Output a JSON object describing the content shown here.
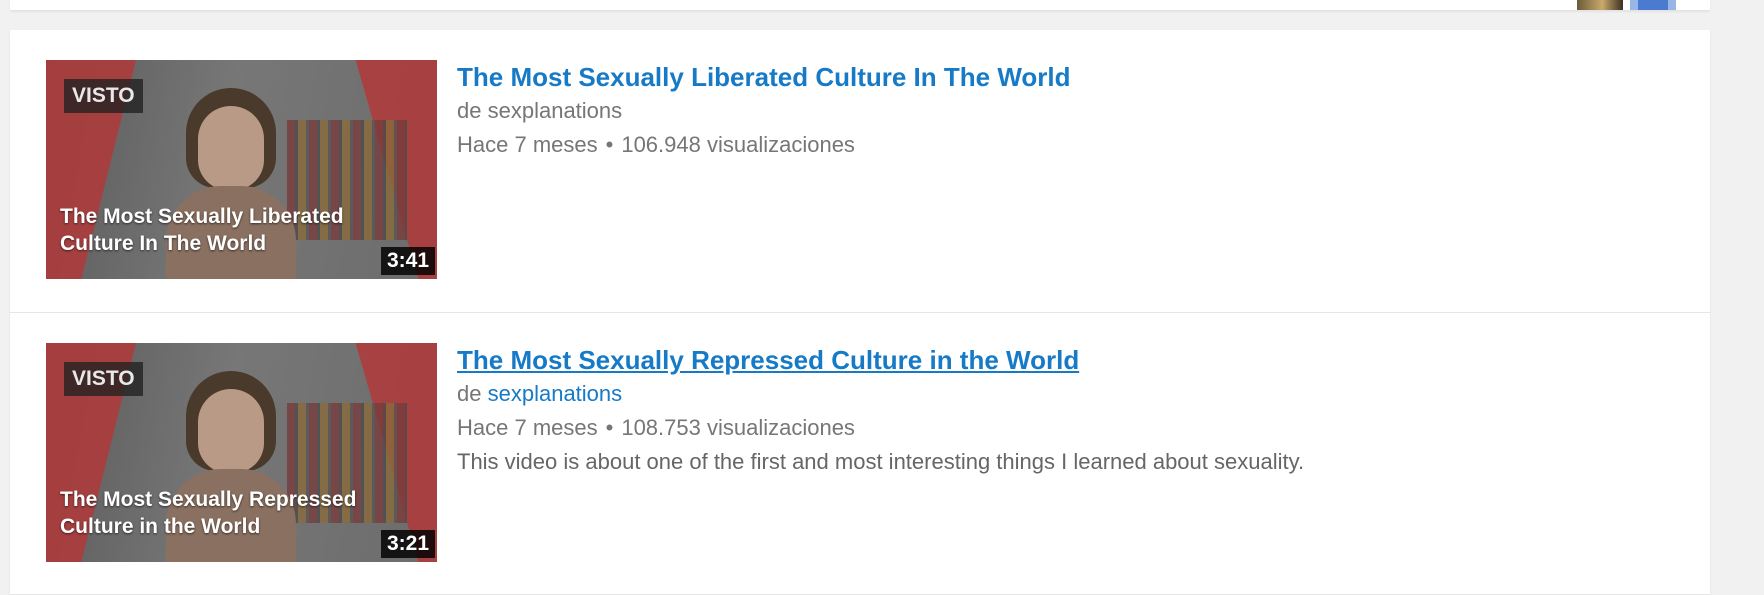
{
  "results": [
    {
      "title": "The Most Sexually Liberated Culture In The World",
      "by_prefix": "de",
      "channel": "sexplanations",
      "age": "Hace 7 meses",
      "views": "106.948 visualizaciones",
      "badge": "VISTO",
      "overlay_title": "The Most Sexually Liberated Culture In The World",
      "duration": "3:41",
      "description": ""
    },
    {
      "title": "The Most Sexually Repressed Culture in the World",
      "by_prefix": "de",
      "channel": "sexplanations",
      "age": "Hace 7 meses",
      "views": "108.753 visualizaciones",
      "badge": "VISTO",
      "overlay_title": "The Most Sexually Repressed Culture in the World",
      "duration": "3:21",
      "description": "This video is about one of the first and most interesting things I learned about sexuality."
    }
  ],
  "separator": "•"
}
